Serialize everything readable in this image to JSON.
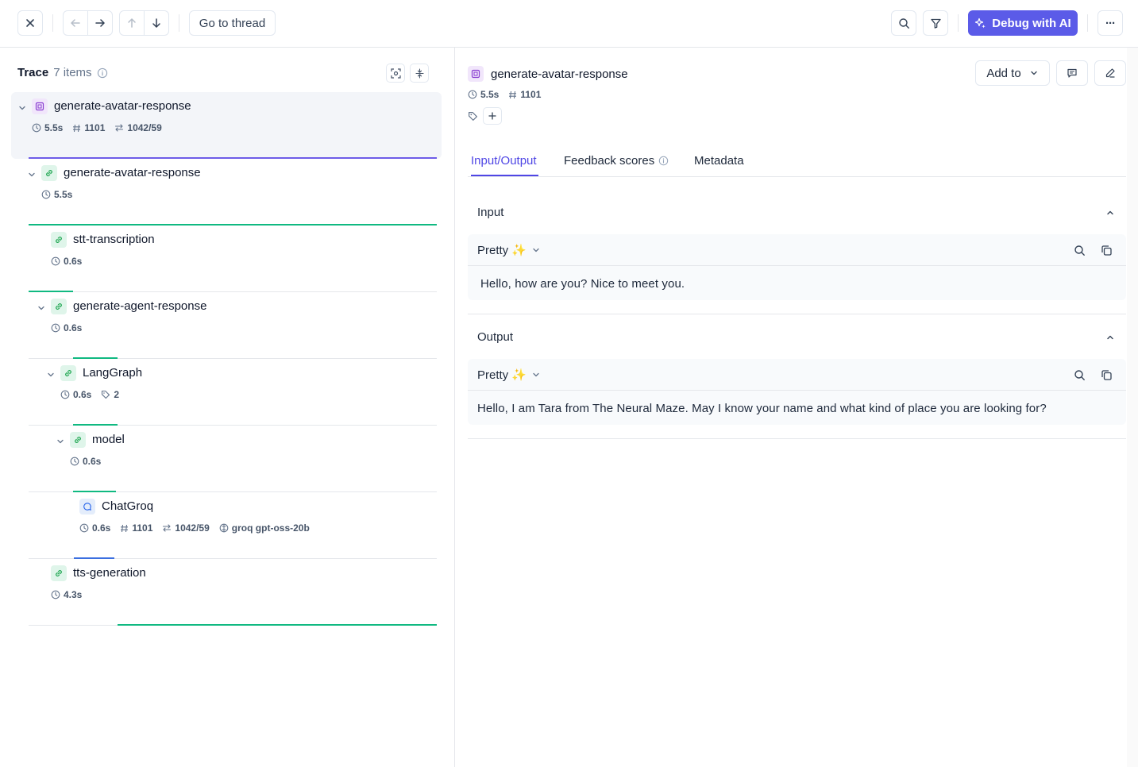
{
  "toolbar": {
    "go_to_thread_label": "Go to thread",
    "debug_label": "Debug with AI",
    "more_label": "···"
  },
  "trace": {
    "title": "Trace",
    "count": "7 items",
    "nodes": [
      {
        "name": "generate-avatar-response",
        "type": "trace",
        "duration": "5.5s",
        "tokens": "1101",
        "io": "1042/59"
      },
      {
        "name": "generate-avatar-response",
        "type": "span",
        "duration": "5.5s"
      },
      {
        "name": "stt-transcription",
        "type": "span",
        "duration": "0.6s"
      },
      {
        "name": "generate-agent-response",
        "type": "span",
        "duration": "0.6s"
      },
      {
        "name": "LangGraph",
        "type": "span",
        "duration": "0.6s",
        "tags": "2"
      },
      {
        "name": "model",
        "type": "span",
        "duration": "0.6s"
      },
      {
        "name": "ChatGroq",
        "type": "llm",
        "duration": "0.6s",
        "tokens": "1101",
        "io": "1042/59",
        "model": "groq gpt-oss-20b"
      },
      {
        "name": "tts-generation",
        "type": "span",
        "duration": "4.3s"
      }
    ]
  },
  "detail": {
    "title": "generate-avatar-response",
    "duration": "5.5s",
    "tokens": "1101",
    "add_to_label": "Add to",
    "tabs": [
      "Input/Output",
      "Feedback scores",
      "Metadata"
    ],
    "input": {
      "heading": "Input",
      "format": "Pretty ✨",
      "text": "Hello, how are you? Nice to meet you."
    },
    "output": {
      "heading": "Output",
      "format": "Pretty ✨",
      "text": "Hello, I am Tara from The Neural Maze. May I know your name and what kind of place you are looking for?"
    }
  },
  "colors": {
    "accent": "#5b5be8",
    "span_bar": "#10b981",
    "trace_bar": "#6d5ce8",
    "llm_bar": "#3b6fe0"
  }
}
